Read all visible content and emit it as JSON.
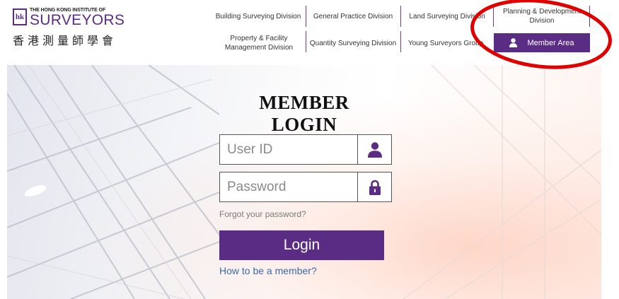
{
  "brand": {
    "org_en_small": "THE HONG KONG INSTITUTE OF",
    "org_en_main": "SURVEYORS",
    "org_cn": "香港測量師學會",
    "mark_letters": "hk"
  },
  "nav": {
    "building": "Building Surveying Division",
    "general": "General Practice Division",
    "land": "Land Surveying Division",
    "planning": "Planning & Development Division",
    "property": "Property & Facility Management Division",
    "quantity": "Quantity Surveying Division",
    "young": "Young Surveyors Group",
    "member_area": "Member Area"
  },
  "login": {
    "title": "MEMBER LOGIN",
    "user_placeholder": "User ID",
    "password_placeholder": "Password",
    "forgot": "Forgot your password?",
    "button": "Login",
    "howto": "How to be a member?"
  },
  "colors": {
    "brand_purple": "#5b2c83",
    "link_blue": "#3a6aa8",
    "annotation_red": "#e00000"
  },
  "icons": {
    "user": "user-icon",
    "lock": "lock-icon",
    "member": "person-icon"
  }
}
